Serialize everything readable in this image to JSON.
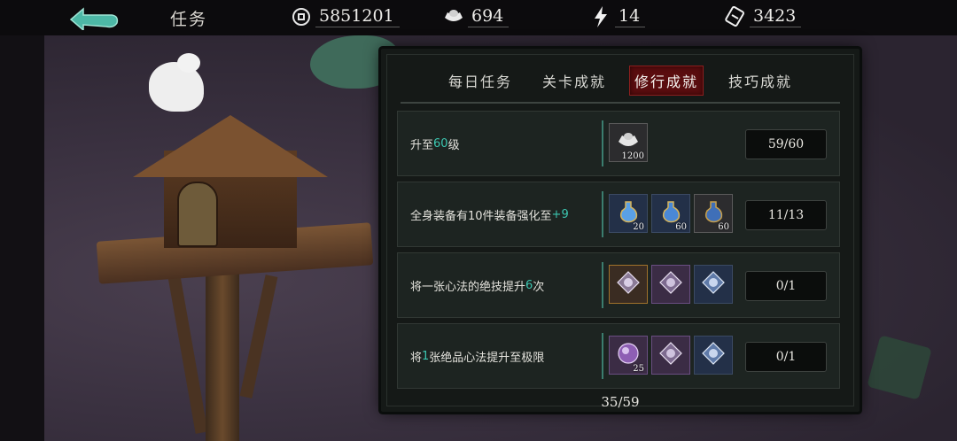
{
  "header": {
    "title": "任务",
    "coins": "5851201",
    "silver": "694",
    "energy": "14",
    "tickets": "3423"
  },
  "tabs": [
    {
      "label": "每日任务",
      "active": false
    },
    {
      "label": "关卡成就",
      "active": false
    },
    {
      "label": "修行成就",
      "active": true
    },
    {
      "label": "技巧成就",
      "active": false
    }
  ],
  "tasks": [
    {
      "desc_parts": [
        "升至",
        "60",
        "级"
      ],
      "rewards": [
        {
          "icon": "silver-ingot-icon",
          "qty": "1200",
          "style": "grey"
        }
      ],
      "progress": "59/60"
    },
    {
      "desc_parts": [
        "全身装备有10件装备强化至",
        "+9",
        ""
      ],
      "rewards": [
        {
          "icon": "potion-flask-icon",
          "qty": "20",
          "style": "blue"
        },
        {
          "icon": "potion-flask-icon",
          "qty": "60",
          "style": "blue"
        },
        {
          "icon": "potion-flask-icon",
          "qty": "60",
          "style": "grey"
        }
      ],
      "progress": "11/13"
    },
    {
      "desc_parts": [
        "将一张心法的绝技提升",
        "6",
        "次"
      ],
      "rewards": [
        {
          "icon": "gem-crystal-icon",
          "qty": "",
          "style": "orange"
        },
        {
          "icon": "gem-crystal-icon",
          "qty": "",
          "style": "purple"
        },
        {
          "icon": "gem-crystal-icon",
          "qty": "",
          "style": "blue"
        }
      ],
      "progress": "0/1"
    },
    {
      "desc_parts": [
        "将",
        "1",
        "张绝品心法提升至极限"
      ],
      "rewards": [
        {
          "icon": "orb-icon",
          "qty": "25",
          "style": "purple"
        },
        {
          "icon": "gem-crystal-icon",
          "qty": "",
          "style": "purple"
        },
        {
          "icon": "gem-crystal-icon",
          "qty": "",
          "style": "blue"
        }
      ],
      "progress": "0/1"
    }
  ],
  "footer_count": "35/59",
  "colors": {
    "highlight": "#3cc6b0",
    "active_tab": "#5a0d0f"
  }
}
